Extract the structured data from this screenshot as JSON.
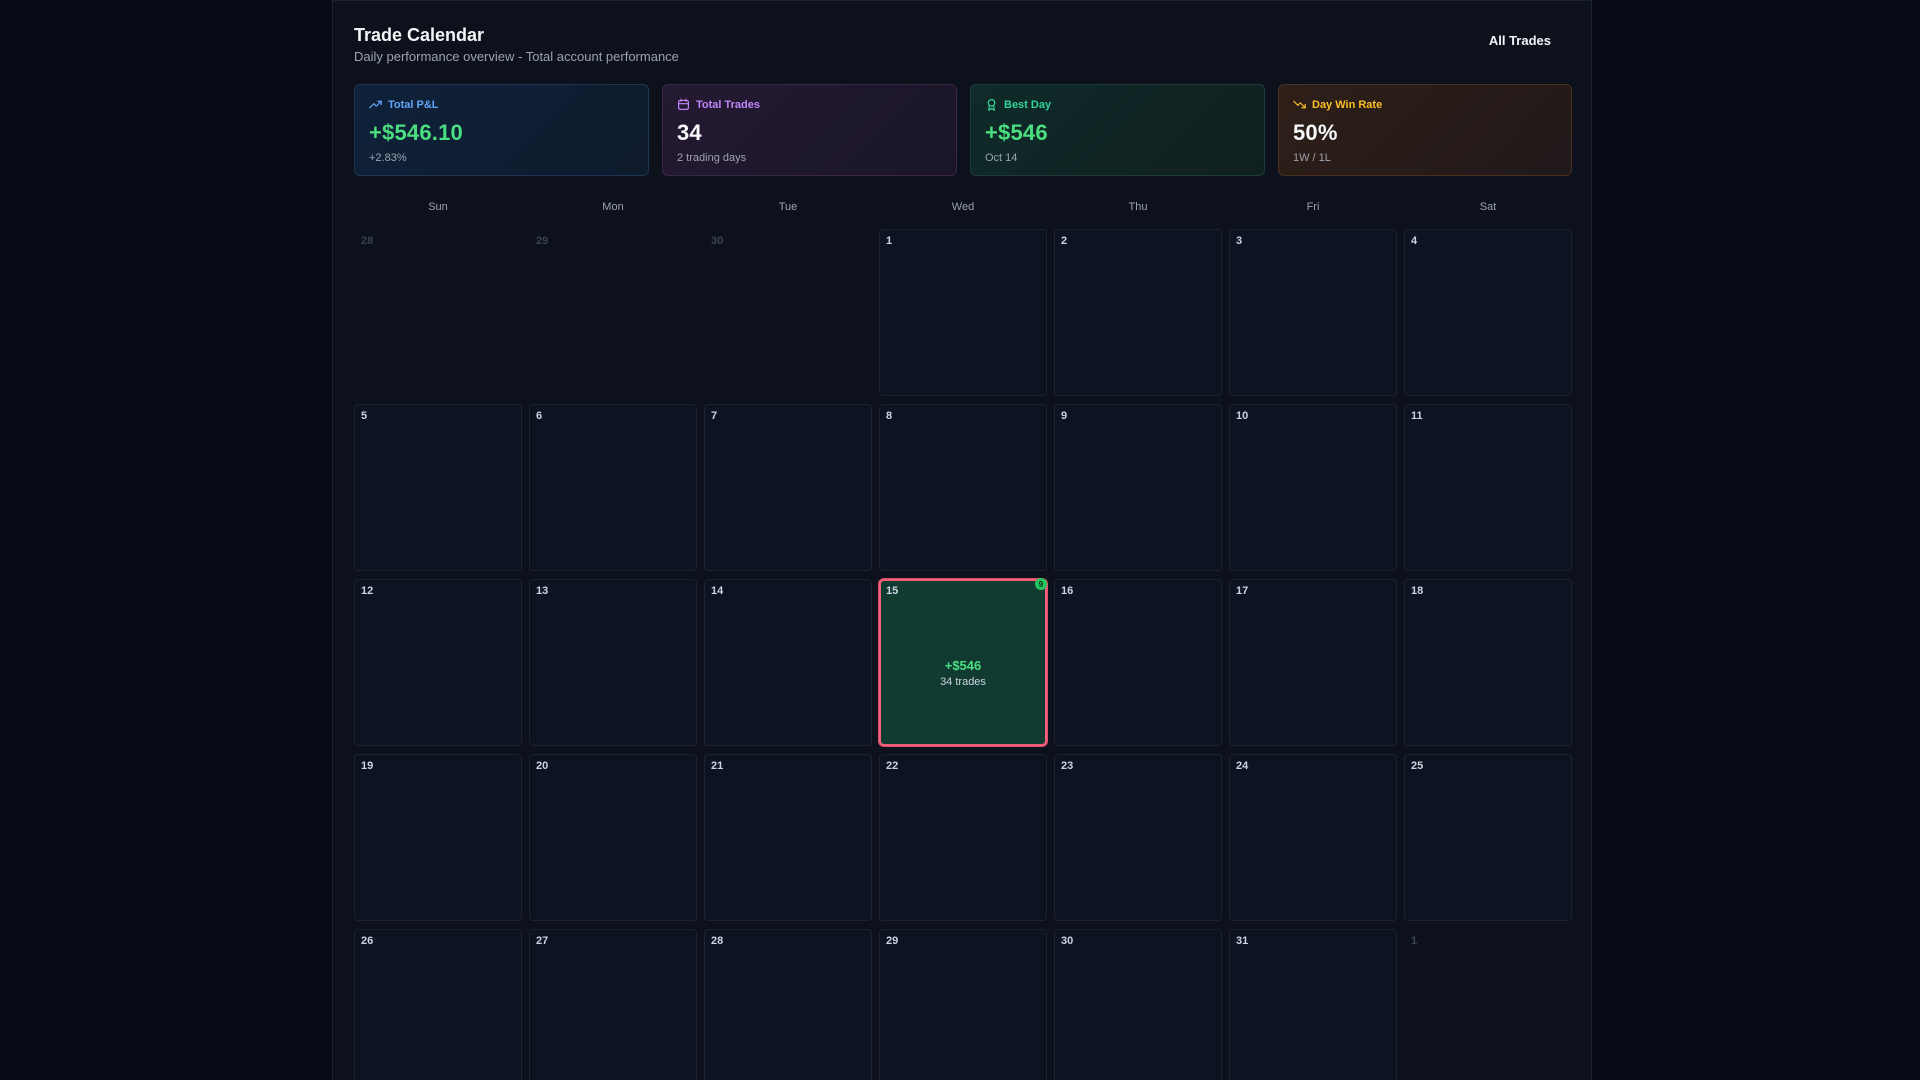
{
  "header": {
    "title": "Trade Calendar",
    "subtitle": "Daily performance overview - Total account performance",
    "all_trades_label": "All Trades"
  },
  "stats": [
    {
      "label": "Total P&L",
      "value": "+$546.10",
      "sub": "+2.83%",
      "icon": "trending-up-icon",
      "color": "#60a5fa"
    },
    {
      "label": "Total Trades",
      "value": "34",
      "sub": "2 trading days",
      "icon": "calendar-icon",
      "color": "#c084fc"
    },
    {
      "label": "Best Day",
      "value": "+$546",
      "sub": "Oct 14",
      "icon": "award-icon",
      "color": "#34d399"
    },
    {
      "label": "Day Win Rate",
      "value": "50%",
      "sub": "1W / 1L",
      "icon": "trending-down-icon",
      "color": "#fbbf24"
    }
  ],
  "weekdays": [
    "Sun",
    "Mon",
    "Tue",
    "Wed",
    "Thu",
    "Fri",
    "Sat"
  ],
  "calendar": {
    "days": [
      {
        "n": "28",
        "muted": true
      },
      {
        "n": "29",
        "muted": true
      },
      {
        "n": "30",
        "muted": true
      },
      {
        "n": "1"
      },
      {
        "n": "2"
      },
      {
        "n": "3"
      },
      {
        "n": "4"
      },
      {
        "n": "5"
      },
      {
        "n": "6"
      },
      {
        "n": "7"
      },
      {
        "n": "8"
      },
      {
        "n": "9"
      },
      {
        "n": "10"
      },
      {
        "n": "11"
      },
      {
        "n": "12"
      },
      {
        "n": "13"
      },
      {
        "n": "14"
      },
      {
        "n": "15",
        "active": true,
        "pnl": "+$546",
        "trades": "34 trades",
        "badge": "9"
      },
      {
        "n": "16"
      },
      {
        "n": "17"
      },
      {
        "n": "18"
      },
      {
        "n": "19"
      },
      {
        "n": "20"
      },
      {
        "n": "21"
      },
      {
        "n": "22"
      },
      {
        "n": "23"
      },
      {
        "n": "24"
      },
      {
        "n": "25"
      },
      {
        "n": "26"
      },
      {
        "n": "27"
      },
      {
        "n": "28"
      },
      {
        "n": "29"
      },
      {
        "n": "30"
      },
      {
        "n": "31"
      },
      {
        "n": "1",
        "muted": true
      }
    ]
  }
}
